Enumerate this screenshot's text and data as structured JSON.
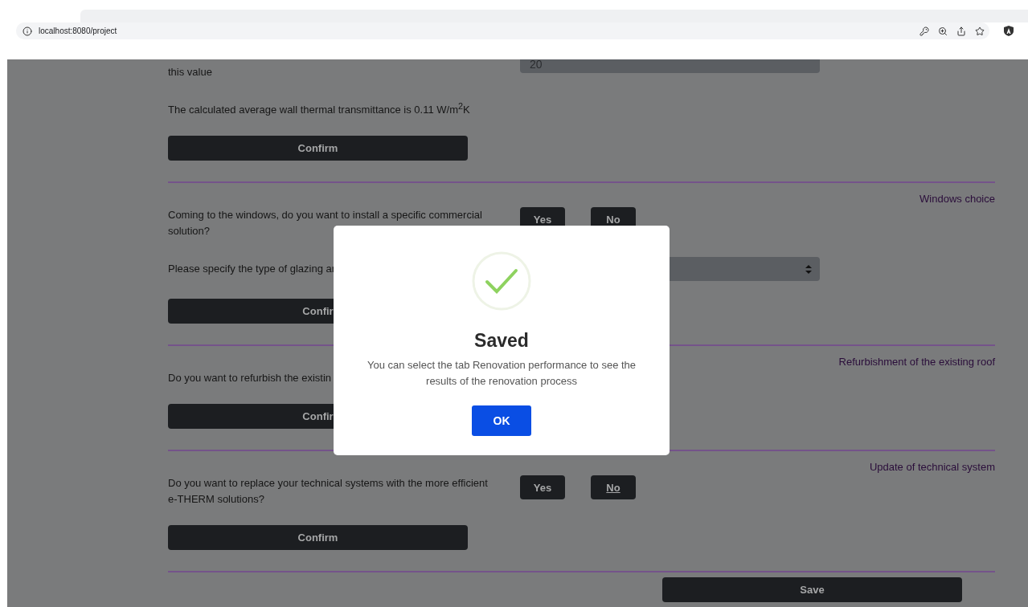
{
  "browser": {
    "url": "localhost:8080/project"
  },
  "sections": [
    {
      "items": [
        {
          "kind": "field_row",
          "label": "this value",
          "value": "20"
        },
        {
          "kind": "text",
          "text": "The calculated average wall thermal transmittance is 0.11 W/m$^{2}$K"
        },
        {
          "kind": "confirm",
          "label": "Confirm"
        }
      ]
    },
    {
      "title": "Windows choice",
      "items": [
        {
          "kind": "question",
          "text": "Coming to the windows, do you want to install a specific commercial solution?",
          "options": [
            {
              "label": "Yes",
              "selected": false
            },
            {
              "label": "No",
              "selected": false
            }
          ]
        },
        {
          "kind": "select_row",
          "label": "Please specify the type of glazing ar"
        },
        {
          "kind": "confirm",
          "label": "Confir"
        }
      ]
    },
    {
      "title": "Refurbishment of the existing roof",
      "items": [
        {
          "kind": "text",
          "text": "Do you want to refurbish the existin"
        },
        {
          "kind": "confirm",
          "label": "Confir"
        }
      ]
    },
    {
      "title": "Update of technical system",
      "items": [
        {
          "kind": "question",
          "text": "Do you want to replace your technical systems with the more efficient e-THERM solutions?",
          "options": [
            {
              "label": "Yes",
              "selected": false
            },
            {
              "label": "No",
              "selected": true
            }
          ]
        },
        {
          "kind": "confirm",
          "label": "Confirm"
        }
      ]
    }
  ],
  "save": {
    "label": "Save"
  },
  "modal": {
    "title": "Saved",
    "message": "You can select the tab Renovation performance to see the results of the renovation process",
    "button": "OK"
  }
}
